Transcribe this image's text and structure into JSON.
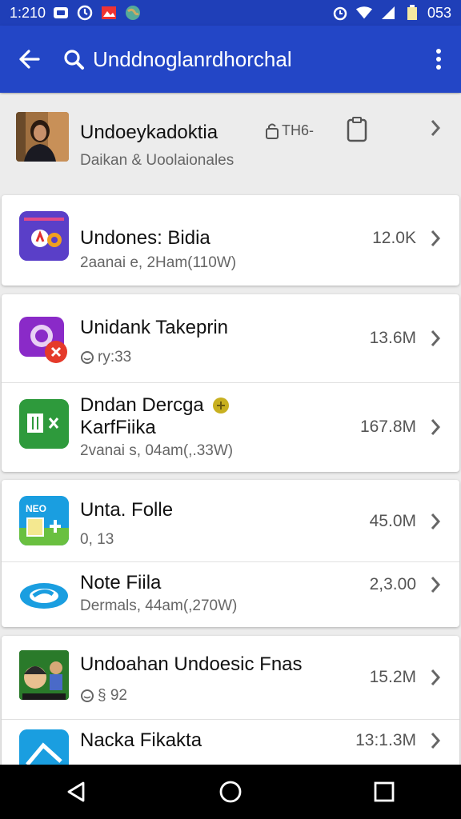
{
  "status_bar": {
    "time": "1:210",
    "battery_text": "053"
  },
  "app_bar": {
    "search_text": "Unddnoglanrdhorchal"
  },
  "header": {
    "title": "Undoeykadoktia",
    "subtitle": "Daikan & Uoolaionales",
    "tag": "TH6-"
  },
  "items": [
    {
      "title": "Undones: Bidia",
      "subtitle": "2aanai e, 2Ham(110W)",
      "size": "12.0K"
    },
    {
      "title": "Unidank Takeprin",
      "subtitle": "ry:33",
      "size": "13.6M"
    },
    {
      "title_line1": "Dndan Dercga",
      "title_line2": "KarfFiika",
      "subtitle": "2vanai s, 04am(,.33W)",
      "size": "167.8M"
    },
    {
      "title": "Unta. Folle",
      "subtitle": "0, 13",
      "size": "45.0M"
    },
    {
      "title": "Note Fiila",
      "subtitle": "Dermals, 44am(,270W)",
      "size": "2,3.00"
    },
    {
      "title": "Undoahan Undoesic Fnas",
      "subtitle": "§ 92",
      "size": "15.2M"
    },
    {
      "title": "Nacka Fikakta",
      "subtitle": "",
      "size": "13:1.3M"
    }
  ],
  "colors": {
    "status_bar": "#1f3fb8",
    "app_bar": "#2346c6",
    "background": "#ececec"
  }
}
